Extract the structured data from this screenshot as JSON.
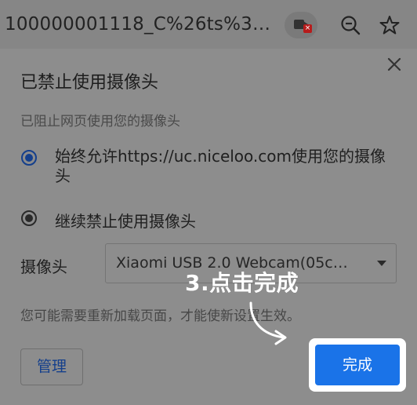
{
  "address_bar": {
    "url_text": "100000001118_C%26ts%3…",
    "icons": [
      "camera-blocked-icon",
      "zoom-out-icon",
      "star-icon"
    ]
  },
  "dialog": {
    "title": "已禁止使用摄像头",
    "subtitle": "已阻止网页使用您的摄像头",
    "option_allow": "始终允许https://uc.niceloo.com使用您的摄像头",
    "option_block": "继续禁止使用摄像头",
    "selected_option": "option_allow",
    "camera_label": "摄像头",
    "camera_device": "Xiaomi USB 2.0 Webcam(05c…",
    "hint": "您可能需要重新加载页面，才能使新设置生效。",
    "manage_label": "管理",
    "done_label": "完成"
  },
  "annotation": {
    "text": "3.点击完成"
  },
  "colors": {
    "accent": "#1a73e8",
    "selected_radio": "#143f8c",
    "overlay": "#8d8d8d"
  }
}
